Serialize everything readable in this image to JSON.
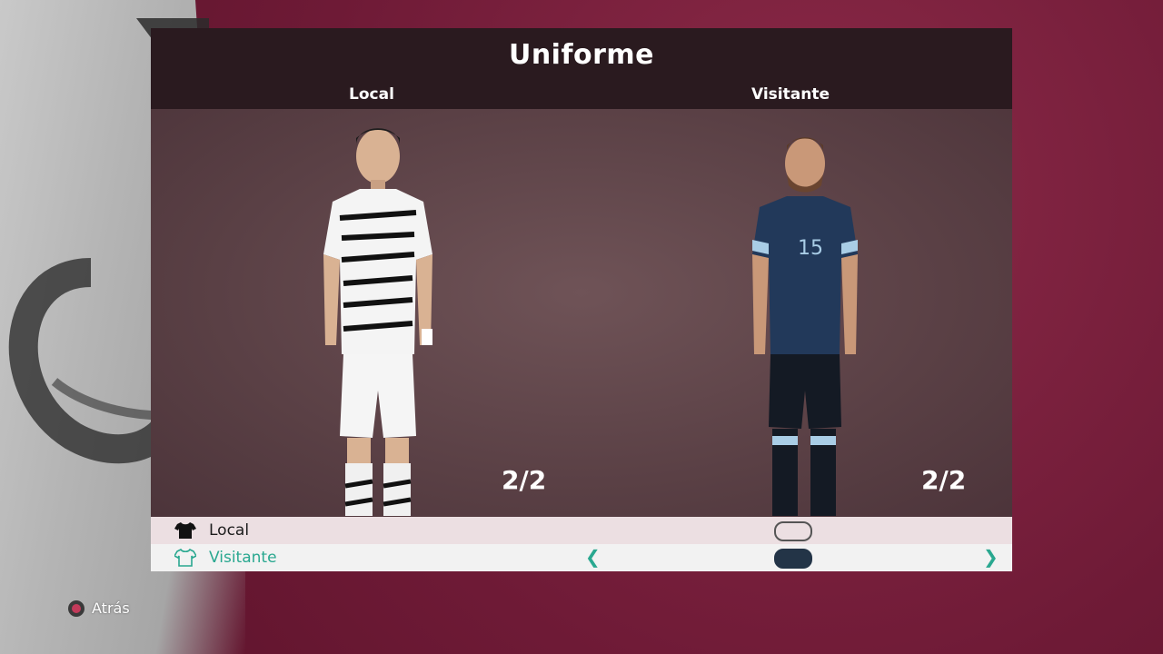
{
  "title": "Uniforme",
  "columns": {
    "home_label": "Local",
    "away_label": "Visitante"
  },
  "counters": {
    "home": "2/2",
    "away": "2/2"
  },
  "kit_rows": [
    {
      "label": "Local",
      "icon": "shirt-filled-icon",
      "toggle": "off"
    },
    {
      "label": "Visitante",
      "icon": "shirt-outline-icon",
      "toggle": "on"
    }
  ],
  "colors": {
    "accent": "#2aa890",
    "background": "#6e1a36",
    "header": "#2a1a1f",
    "toggle_on": "#233447"
  },
  "footer": {
    "back_label": "Atrás",
    "back_icon": "circle-button-icon"
  }
}
